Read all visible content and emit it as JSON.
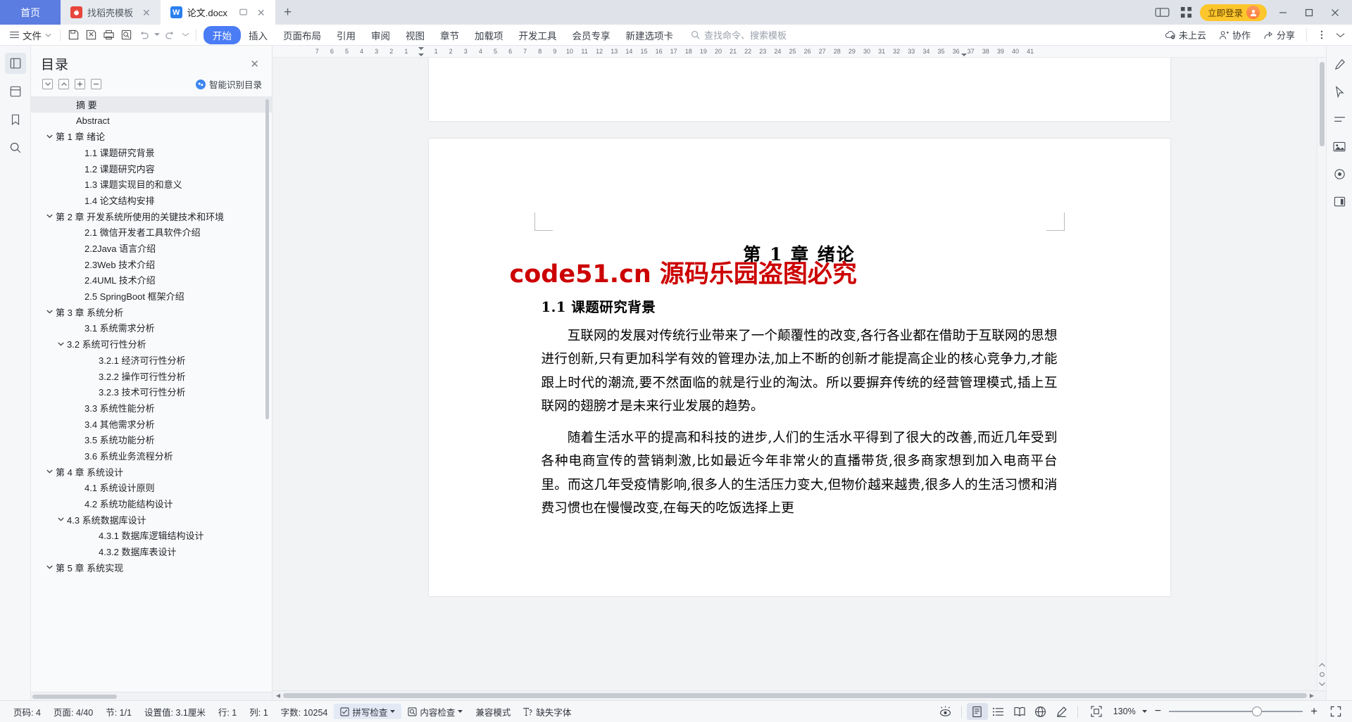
{
  "window": {
    "tabs": [
      {
        "label": "首页",
        "type": "home"
      },
      {
        "label": "找稻壳模板",
        "type": "inactive",
        "icon": "docer-icon"
      },
      {
        "label": "论文.docx",
        "type": "active",
        "icon": "word-icon"
      }
    ],
    "new_tab_label": "+",
    "login_label": "立即登录",
    "minimize_label": "─",
    "maximize_label": "❐",
    "close_label": "✕"
  },
  "ribbon": {
    "file_label": "文件",
    "tabs": [
      {
        "label": "开始",
        "selected": true
      },
      {
        "label": "插入",
        "selected": false
      },
      {
        "label": "页面布局",
        "selected": false
      },
      {
        "label": "引用",
        "selected": false
      },
      {
        "label": "审阅",
        "selected": false
      },
      {
        "label": "视图",
        "selected": false
      },
      {
        "label": "章节",
        "selected": false
      },
      {
        "label": "加载项",
        "selected": false
      },
      {
        "label": "开发工具",
        "selected": false
      },
      {
        "label": "会员专享",
        "selected": false
      },
      {
        "label": "新建选项卡",
        "selected": false
      }
    ],
    "search_placeholder": "查找命令、搜索模板",
    "right_items": [
      {
        "label": "未上云",
        "icon": "cloud-off-icon"
      },
      {
        "label": "协作",
        "icon": "collaborate-icon"
      },
      {
        "label": "分享",
        "icon": "share-icon"
      }
    ]
  },
  "toc": {
    "title": "目录",
    "close_label": "✕",
    "tools": [
      "expand-down",
      "collapse-up",
      "plus",
      "minus"
    ],
    "smart_label": "智能识别目录",
    "items": [
      {
        "label": "摘 要",
        "level": 1,
        "caret": "",
        "selected": true
      },
      {
        "label": "Abstract",
        "level": 1,
        "caret": "",
        "selected": false
      },
      {
        "label": "第 1 章 绪论",
        "level": 0,
        "caret": "down",
        "selected": false
      },
      {
        "label": "1.1 课题研究背景",
        "level": 2,
        "caret": "",
        "selected": false
      },
      {
        "label": "1.2 课题研究内容",
        "level": 2,
        "caret": "",
        "selected": false
      },
      {
        "label": "1.3 课题实现目的和意义",
        "level": 2,
        "caret": "",
        "selected": false
      },
      {
        "label": "1.4 论文结构安排",
        "level": 2,
        "caret": "",
        "selected": false
      },
      {
        "label": "第 2 章 开发系统所使用的关键技术和环境",
        "level": 0,
        "caret": "down",
        "selected": false
      },
      {
        "label": "2.1 微信开发者工具软件介绍",
        "level": 2,
        "caret": "",
        "selected": false
      },
      {
        "label": "2.2Java 语言介绍",
        "level": 2,
        "caret": "",
        "selected": false
      },
      {
        "label": "2.3Web 技术介绍",
        "level": 2,
        "caret": "",
        "selected": false
      },
      {
        "label": "2.4UML 技术介绍",
        "level": 2,
        "caret": "",
        "selected": false
      },
      {
        "label": "2.5 SpringBoot 框架介绍",
        "level": 2,
        "caret": "",
        "selected": false
      },
      {
        "label": "第 3 章 系统分析",
        "level": 0,
        "caret": "down",
        "selected": false
      },
      {
        "label": "3.1 系统需求分析",
        "level": 2,
        "caret": "",
        "selected": false
      },
      {
        "label": "3.2 系统可行性分析",
        "level": 1,
        "caret": "down",
        "selected": false
      },
      {
        "label": "3.2.1 经济可行性分析",
        "level": 3,
        "caret": "",
        "selected": false
      },
      {
        "label": "3.2.2 操作可行性分析",
        "level": 3,
        "caret": "",
        "selected": false
      },
      {
        "label": "3.2.3 技术可行性分析",
        "level": 3,
        "caret": "",
        "selected": false
      },
      {
        "label": "3.3 系统性能分析",
        "level": 2,
        "caret": "",
        "selected": false
      },
      {
        "label": "3.4 其他需求分析",
        "level": 2,
        "caret": "",
        "selected": false
      },
      {
        "label": "3.5 系统功能分析",
        "level": 2,
        "caret": "",
        "selected": false
      },
      {
        "label": "3.6 系统业务流程分析",
        "level": 2,
        "caret": "",
        "selected": false
      },
      {
        "label": "第 4 章 系统设计",
        "level": 0,
        "caret": "down",
        "selected": false
      },
      {
        "label": "4.1 系统设计原则",
        "level": 2,
        "caret": "",
        "selected": false
      },
      {
        "label": "4.2 系统功能结构设计",
        "level": 2,
        "caret": "",
        "selected": false
      },
      {
        "label": "4.3 系统数据库设计",
        "level": 1,
        "caret": "down",
        "selected": false
      },
      {
        "label": "4.3.1 数据库逻辑结构设计",
        "level": 3,
        "caret": "",
        "selected": false
      },
      {
        "label": "4.3.2 数据库表设计",
        "level": 3,
        "caret": "",
        "selected": false
      },
      {
        "label": "第 5 章 系统实现",
        "level": 0,
        "caret": "down",
        "selected": false
      }
    ]
  },
  "ruler": {
    "left_ticks": [
      "7",
      "6",
      "5",
      "4",
      "3",
      "2",
      "1"
    ],
    "right_ticks": [
      "1",
      "2",
      "3",
      "4",
      "5",
      "6",
      "7",
      "8",
      "9",
      "10",
      "11",
      "12",
      "13",
      "14",
      "15",
      "16",
      "17",
      "18",
      "19",
      "20",
      "21",
      "22",
      "23",
      "24",
      "25",
      "26",
      "27",
      "28",
      "29",
      "30",
      "31",
      "32",
      "33",
      "34",
      "35",
      "36",
      "37",
      "38",
      "39",
      "40",
      "41"
    ]
  },
  "document": {
    "heading1": "第 1 章 绪论",
    "heading2": "1.1 课题研究背景",
    "watermark": "code51.cn 源码乐园盗图必究",
    "watermark_color": "#cc0000",
    "paragraphs": [
      "互联网的发展对传统行业带来了一个颠覆性的改变,各行各业都在借助于互联网的思想进行创新,只有更加科学有效的管理办法,加上不断的创新才能提高企业的核心竞争力,才能跟上时代的潮流,要不然面临的就是行业的淘汰。所以要摒弃传统的经营管理模式,插上互联网的翅膀才是未来行业发展的趋势。",
      "随着生活水平的提高和科技的进步,人们的生活水平得到了很大的改善,而近几年受到各种电商宣传的营销刺激,比如最近今年非常火的直播带货,很多商家想到加入电商平台里。而这几年受疫情影响,很多人的生活压力变大,但物价越来越贵,很多人的生活习惯和消费习惯也在慢慢改变,在每天的吃饭选择上更"
    ]
  },
  "status": {
    "left_items": [
      {
        "label": "页码: 4",
        "name": "page-number"
      },
      {
        "label": "页面: 4/40",
        "name": "page-count"
      },
      {
        "label": "节: 1/1",
        "name": "section"
      },
      {
        "label": "设置值: 3.1厘米",
        "name": "setting-value"
      },
      {
        "label": "行: 1",
        "name": "row"
      },
      {
        "label": "列: 1",
        "name": "column"
      },
      {
        "label": "字数: 10254",
        "name": "word-count"
      }
    ],
    "spell_check": "拼写检查",
    "content_check": "内容检查",
    "compat_mode": "兼容模式",
    "missing_font": "缺失字体",
    "zoom_level": "130%",
    "zoom_minus": "−",
    "zoom_plus": "+"
  }
}
